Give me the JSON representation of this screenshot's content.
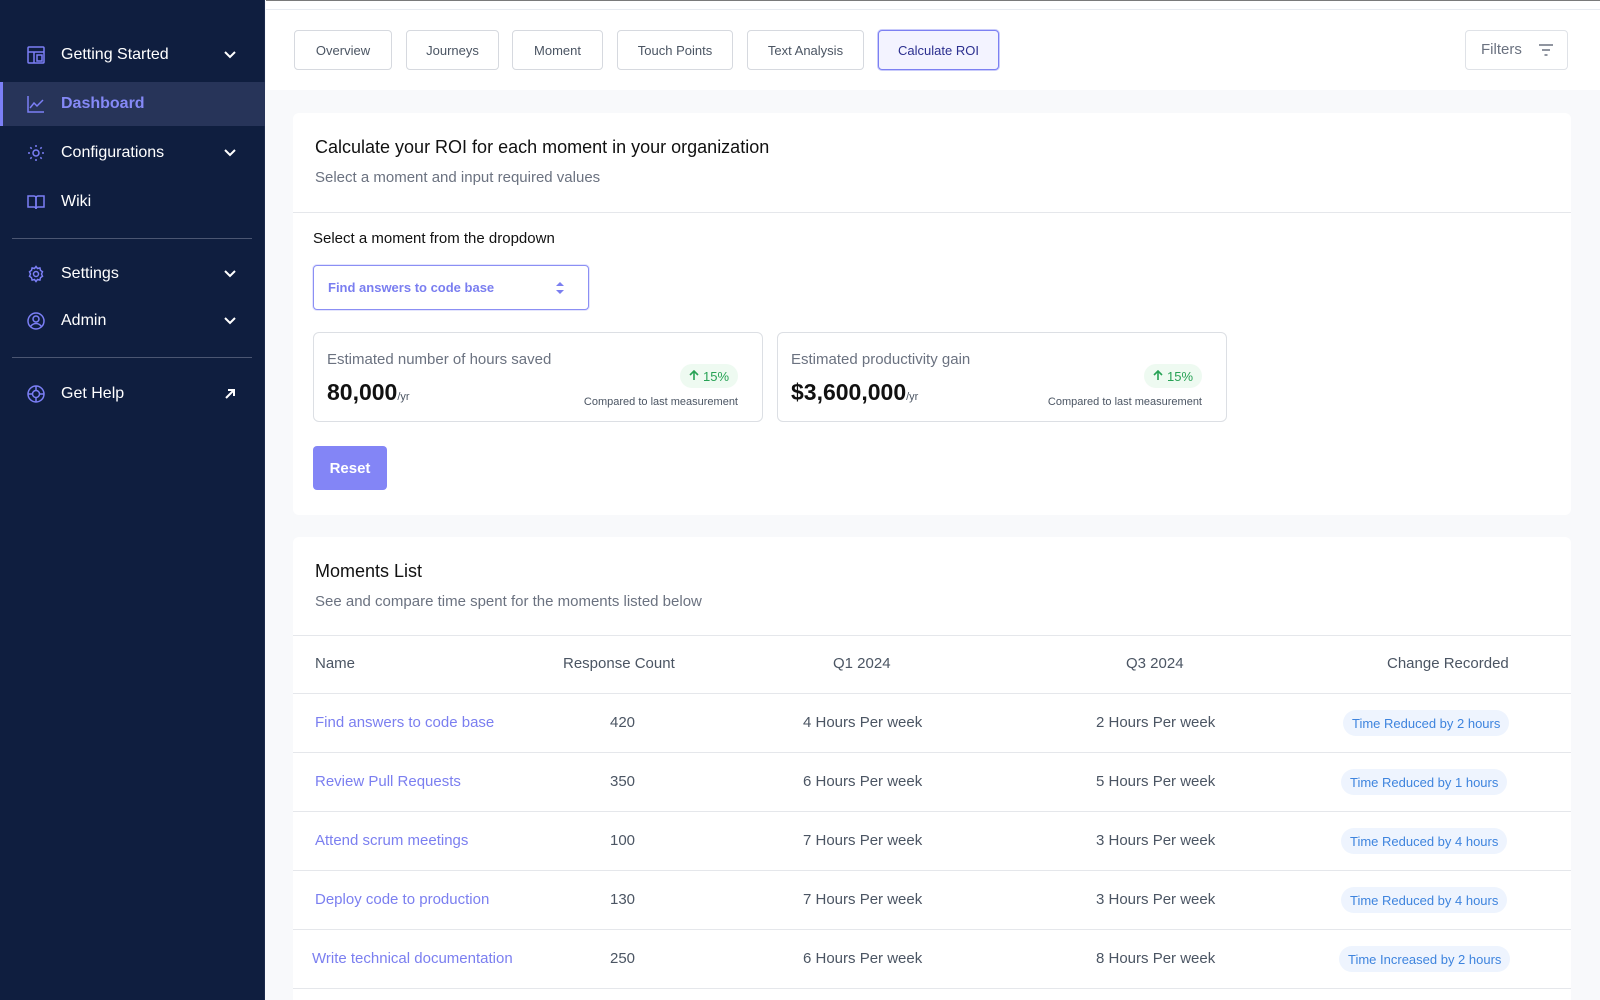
{
  "sidebar": {
    "items": [
      {
        "label": "Getting Started",
        "icon": "layout-icon",
        "expandable": true
      },
      {
        "label": "Dashboard",
        "icon": "chart-line-icon",
        "active": true
      },
      {
        "label": "Configurations",
        "icon": "cog-icon",
        "expandable": true
      },
      {
        "label": "Wiki",
        "icon": "book-icon"
      },
      {
        "label": "Settings",
        "icon": "settings-icon",
        "expandable": true
      },
      {
        "label": "Admin",
        "icon": "user-circle-icon",
        "expandable": true
      },
      {
        "label": "Get Help",
        "icon": "lifebuoy-icon",
        "external": true
      }
    ]
  },
  "tabs": [
    {
      "label": "Overview"
    },
    {
      "label": "Journeys"
    },
    {
      "label": "Moment"
    },
    {
      "label": "Touch Points"
    },
    {
      "label": "Text Analysis"
    },
    {
      "label": "Calculate ROI",
      "active": true
    }
  ],
  "filters": {
    "label": "Filters",
    "icon": "filter-icon"
  },
  "roi": {
    "title": "Calculate your ROI for each moment in your organization",
    "subtitle": "Select a moment and input required values",
    "select_label": "Select a moment from the dropdown",
    "selected_moment": "Find answers to code base",
    "metrics": [
      {
        "label": "Estimated number of hours saved",
        "value": "80,000",
        "unit": "/yr",
        "change": "15%",
        "direction": "up",
        "compare": "Compared to last measurement"
      },
      {
        "label": "Estimated productivity gain",
        "value": "$3,600,000",
        "unit": "/yr",
        "change": "15%",
        "direction": "up",
        "compare": "Compared to last measurement"
      }
    ],
    "reset_label": "Reset"
  },
  "moments": {
    "title": "Moments List",
    "subtitle": "See and compare time spent for the moments listed below",
    "columns": [
      "Name",
      "Response Count",
      "Q1 2024",
      "Q3 2024",
      "Change Recorded"
    ],
    "rows": [
      {
        "name": "Find answers to code base",
        "count": "420",
        "q1": "4 Hours Per week",
        "q3": "2 Hours Per week",
        "change": "Time Reduced by 2 hours"
      },
      {
        "name": "Review Pull Requests",
        "count": "350",
        "q1": "6 Hours Per week",
        "q3": "5 Hours Per week",
        "change": "Time Reduced by 1 hours"
      },
      {
        "name": "Attend scrum meetings",
        "count": "100",
        "q1": "7 Hours Per week",
        "q3": "3 Hours Per week",
        "change": "Time Reduced by 4 hours"
      },
      {
        "name": "Deploy code to production",
        "count": "130",
        "q1": "7 Hours Per week",
        "q3": "3 Hours Per week",
        "change": "Time Reduced by 4 hours"
      },
      {
        "name": "Write technical documentation",
        "count": "250",
        "q1": "6 Hours Per week",
        "q3": "8 Hours Per week",
        "change": "Time Increased by 2 hours"
      }
    ]
  },
  "colors": {
    "sidebar_bg": "#0f1e3f",
    "accent": "#7b7ff6",
    "positive": "#27a255",
    "pill_text": "#3e84de"
  }
}
